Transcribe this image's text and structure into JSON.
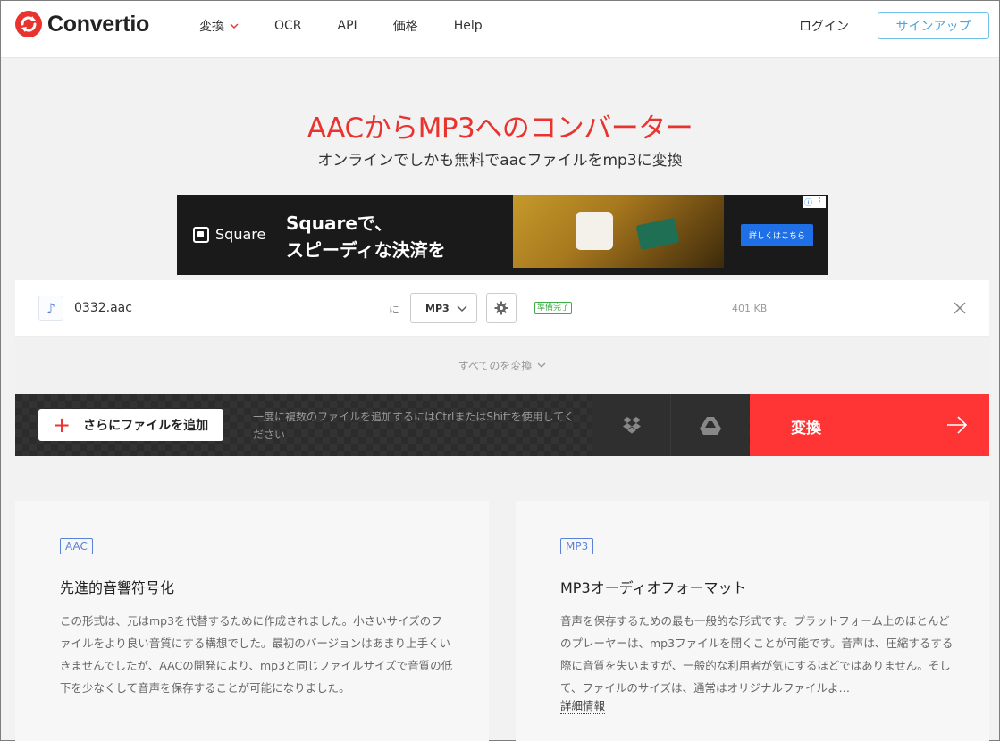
{
  "header": {
    "logo_text": "Convertio",
    "nav": [
      {
        "label": "変換",
        "has_dropdown": true
      },
      {
        "label": "OCR"
      },
      {
        "label": "API"
      },
      {
        "label": "価格"
      },
      {
        "label": "Help"
      }
    ],
    "login": "ログイン",
    "signup": "サインアップ"
  },
  "hero": {
    "title": "AACからMP3へのコンバーター",
    "subtitle": "オンラインでしかも無料でaacファイルをmp3に変換"
  },
  "ad": {
    "brand": "Square",
    "headline_line1": "Squareで、",
    "headline_line2": "スピーディな決済を",
    "cta": "詳しくはこちら"
  },
  "file": {
    "name": "0332.aac",
    "to_label": "に",
    "format": "MP3",
    "status": "準備完了",
    "size": "401 KB"
  },
  "convert_all": "すべてのを変換",
  "action_bar": {
    "add_files": "さらにファイルを追加",
    "hint": "一度に複数のファイルを追加するにはCtrlまたはShiftを使用してください",
    "convert": "変換"
  },
  "cards": [
    {
      "badge": "AAC",
      "title": "先進的音響符号化",
      "text": "この形式は、元はmp3を代替するために作成されました。小さいサイズのファイルをより良い音質にする構想でした。最初のバージョンはあまり上手くいきませんでしたが、AACの開発により、mp3と同じファイルサイズで音質の低下を少なくして音声を保存することが可能になりました。"
    },
    {
      "badge": "MP3",
      "title": "MP3オーディオフォーマット",
      "text": "音声を保存するための最も一般的な形式です。プラットフォーム上のほとんどのプレーヤーは、mp3ファイルを開くことが可能です。音声は、圧縮するする際に音質を失いますが、一般的な利用者が気にするほどではありません。そして、ファイルのサイズは、通常はオリジナルファイルよ…",
      "more": "詳細情報"
    }
  ],
  "colors": {
    "brand_red": "#e8332f",
    "convert_red": "#ff3535",
    "signup_blue": "#4aa8db",
    "status_green": "#3fae49"
  }
}
